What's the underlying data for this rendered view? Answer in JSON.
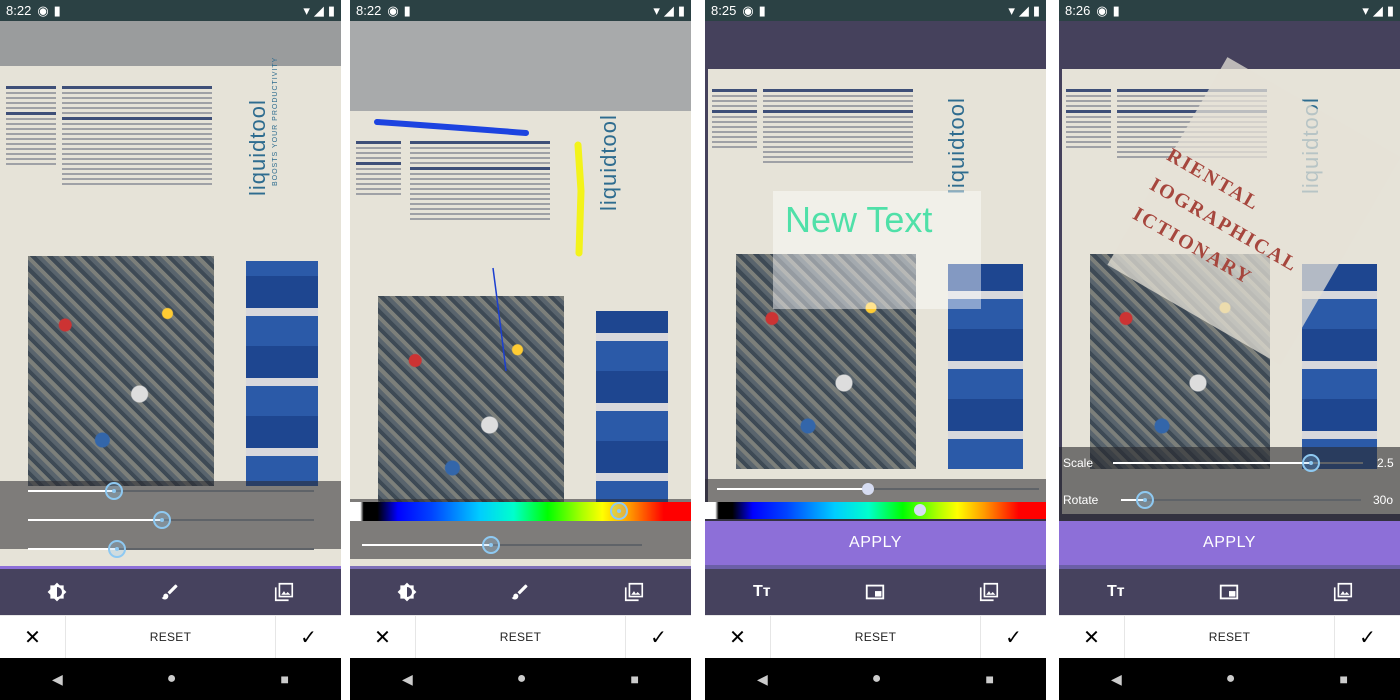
{
  "screens": [
    {
      "status": {
        "time": "8:22"
      },
      "toolbar": {
        "icons": [
          "brightness-icon",
          "brush-icon",
          "image-icon"
        ]
      },
      "sliders": [
        {
          "value": 0.3
        },
        {
          "value": 0.47
        },
        {
          "value": 0.31
        }
      ]
    },
    {
      "status": {
        "time": "8:22"
      },
      "toolbar": {
        "icons": [
          "brightness-icon",
          "brush-icon",
          "image-icon"
        ]
      },
      "color_slider": {
        "value": 0.79
      },
      "size_slider": {
        "value": 0.46
      }
    },
    {
      "status": {
        "time": "8:25"
      },
      "overlay_text": "New Text",
      "apply_label": "APPLY",
      "toolbar": {
        "icons": [
          "text-icon",
          "sticker-icon",
          "image-icon"
        ]
      },
      "opacity_slider": {
        "value": 0.47
      },
      "color_slider": {
        "value": 0.63
      }
    },
    {
      "status": {
        "time": "8:26"
      },
      "stamp_text": [
        "RIENTAL",
        "IOGRAPHICAL",
        "ICTIONARY"
      ],
      "scale": {
        "label": "Scale",
        "value": "2.5",
        "fraction": 0.79
      },
      "rotate": {
        "label": "Rotate",
        "value": "30o",
        "fraction": 0.1
      },
      "apply_label": "APPLY",
      "toolbar": {
        "icons": [
          "text-icon",
          "sticker-icon",
          "image-icon"
        ]
      }
    }
  ],
  "action_bar": {
    "reset_label": "RESET"
  },
  "brand": {
    "name": "liquidtool",
    "tagline": "BOOSTS YOUR PRODUCTIVITY"
  },
  "colors": {
    "status_bar": "#2b4144",
    "toolbar": "#46425e",
    "accent": "#8d6fd8",
    "thumb": "#8ec9f2"
  }
}
